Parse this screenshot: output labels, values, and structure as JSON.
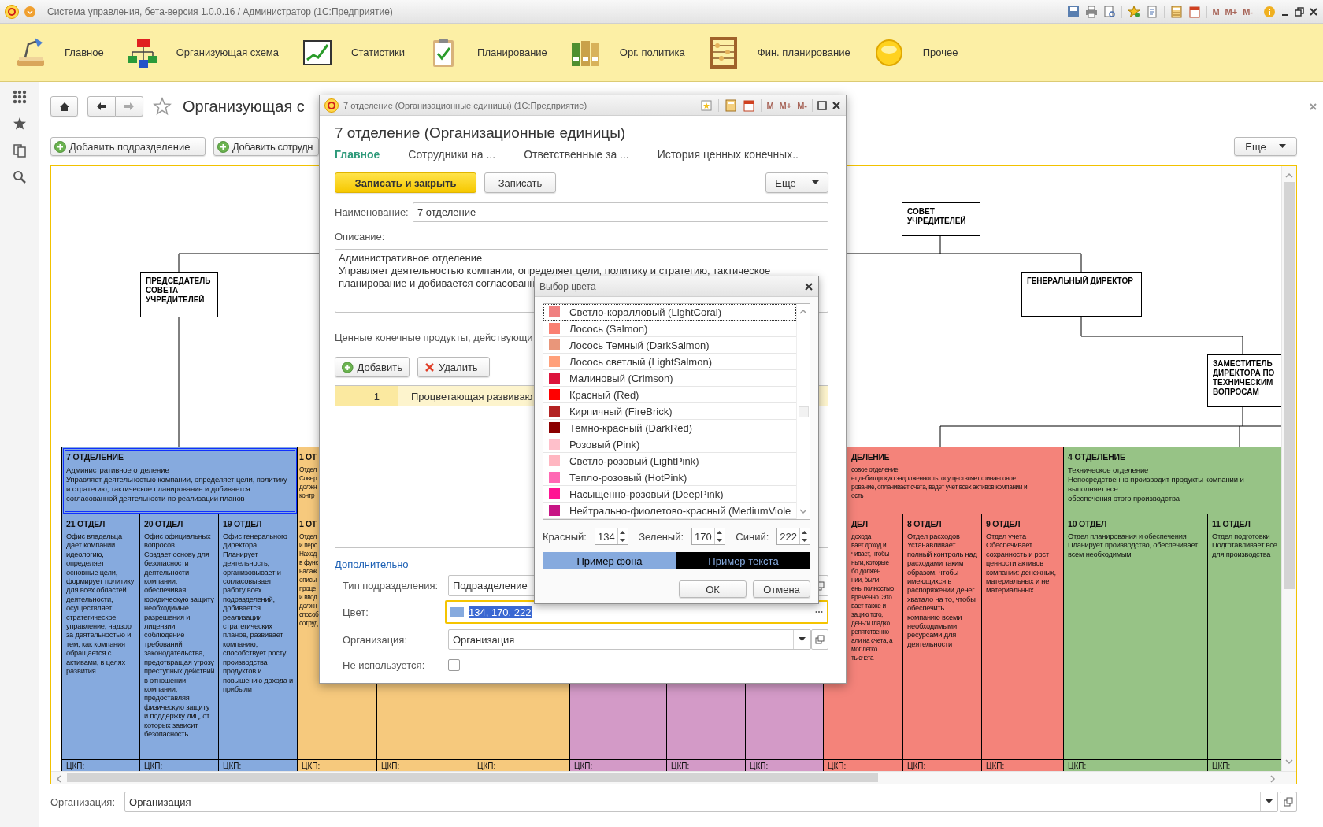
{
  "app_window": {
    "title": "Система управления, бета-версия 1.0.0.16 / Администратор  (1С:Предприятие)",
    "memory_buttons": [
      "M",
      "M+",
      "M-"
    ]
  },
  "sections": [
    {
      "label": "Главное"
    },
    {
      "label": "Организующая схема"
    },
    {
      "label": "Статистики"
    },
    {
      "label": "Планирование"
    },
    {
      "label": "Орг. политика"
    },
    {
      "label": "Фин. планирование"
    },
    {
      "label": "Прочее"
    }
  ],
  "page": {
    "title": "Организующая с",
    "buttons": [
      "Добавить подразделение",
      "Добавить сотрудн"
    ],
    "more_button": "Еще"
  },
  "chart": {
    "nodes": [
      {
        "label": "СОВЕТ УЧРЕДИТЕЛЕЙ"
      },
      {
        "label": "ПРЕДСЕДАТЕЛЬ СОВЕТА УЧРЕДИТЕЛЕЙ"
      },
      {
        "label": "ГЕНЕРАЛЬНЫЙ ДИРЕКТОР"
      },
      {
        "label": "ЗАМЕСТИТЕЛЬ ДИРЕКТОРА ПО ТЕХНИЧЕСКИМ ВОПРОСАМ"
      }
    ],
    "departments": [
      {
        "kind": "full",
        "color": "#86aade",
        "selected": true,
        "heading": "7 ОТДЕЛЕНИЕ",
        "text": "Административное отделение\nУправляет деятельностью компании, определяет цели, политику и стратегию, тактическое планирование и добивается согласованной деятельности по реализации планов",
        "units": [
          {
            "kind": "full",
            "heading": "21 ОТДЕЛ",
            "text": "Офис владельца\nДает компании идеологию, определяет основные цели, формирует политику для всех областей деятельности, осуществляет стратегическое управление, надзор за деятельностью и тем, как компания обращается с активами, в целях развития",
            "footer": "ЦКП:"
          },
          {
            "kind": "full",
            "heading": "20 ОТДЕЛ",
            "text": "Офис официальных вопросов\nСоздает основу для безопасности деятельности компании, обеспечивая юридическую защиту необходимые разрешения и лицензии, соблюдение требований законодательства, предотвращая угрозу преступных действий в отношении компании, предоставляя физическую защиту и поддержку лиц, от которых зависит безопасность",
            "footer": "ЦКП:"
          },
          {
            "kind": "full",
            "heading": "19 ОТДЕЛ",
            "text": "Офис генерального директора\nПланирует деятельность, организовывает и согласовывает работу всех подразделений, добивается реализации стратегических планов, развивает компанию, способствует росту производства продуктов и повышению дохода и прибыли",
            "footer": "ЦКП:"
          }
        ]
      },
      {
        "kind": "cut-right",
        "color": "#f6c97d",
        "selected": false,
        "heading": "1 ОТ",
        "text": "Отдел\nСовер\nдолжн\nконтр",
        "units": [
          {
            "kind": "cut-right",
            "heading": "1 ОТ",
            "text": "Отдел\nи перс\nНаход\nв функ\nналаж\nописы\nпроце\nи ввод\nдолжн\nспособ\nсотруд",
            "footer": "ЦКП:"
          },
          {
            "footer": "ЦКП:"
          },
          {
            "footer": "ЦКП:"
          }
        ]
      },
      {
        "color": "#d39ac7",
        "units": [
          {
            "footer": "ЦКП:"
          },
          {
            "footer": "ЦКП:"
          },
          {
            "footer": "ЦКП:"
          }
        ]
      },
      {
        "kind": "cut-left",
        "color": "#f4837a",
        "selected": false,
        "heading": "ДЕЛЕНИЕ",
        "text": "совое отделение\nет дебиторскую задолженность, осуществляет финансовое\nрование, оплачивает счета, ведет учет всех активов компании и\nость",
        "units": [
          {
            "kind": "cut-left",
            "heading": "ДЕЛ",
            "text": "дохода\nвает доход и\nчивает, чтобы\nньги, которые\nбо должен\nнии, были\nены полностью\nвременно. Это\nвает также и\nзацию того,\nденьги гладко\nрепятственно\nали на счета, а\nмог легко\nть счета",
            "footer": "ЦКП:"
          },
          {
            "kind": "full",
            "heading": "8 ОТДЕЛ",
            "text": "Отдел расходов\nУстанавливает полный контроль над расходами таким образом, чтобы имеющихся в распоряжении денег хватало на то, чтобы обеспечить компанию всеми необходимыми ресурсами для деятельности",
            "footer": "ЦКП:"
          },
          {
            "kind": "full",
            "heading": "9 ОТДЕЛ",
            "text": "Отдел учета\nОбеспечивает сохранность и рост ценности активов компании: денежных, материальных и не материальных",
            "footer": "ЦКП:"
          }
        ]
      },
      {
        "kind": "full",
        "color": "#97c386",
        "selected": false,
        "heading": "4 ОТДЕЛЕНИЕ",
        "text": "Техническое отделение\nНепосредственно производит продукты компании и выполняет все\nобеспечения этого производства",
        "units": [
          {
            "kind": "full",
            "heading": "10 ОТДЕЛ",
            "text": "Отдел планирования и обеспечения\nПланирует производство, обеспечивает всем необходимым",
            "footer": "ЦКП:"
          },
          {
            "kind": "full",
            "heading": "11 ОТДЕЛ",
            "text": "Отдел подготовки\nПодготавливает все для производства",
            "footer": "ЦКП:"
          }
        ]
      }
    ]
  },
  "organization_field": {
    "label": "Организация:",
    "value": "Организация"
  },
  "dialog": {
    "window_title": "7 отделение (Организационные единицы)  (1С:Предприятие)",
    "memory_buttons": [
      "M",
      "M+",
      "M-"
    ],
    "heading": "7 отделение (Организационные единицы)",
    "tabs": [
      {
        "label": "Главное",
        "selected": true
      },
      {
        "label": "Сотрудники на ...",
        "selected": false
      },
      {
        "label": "Ответственные за ...",
        "selected": false
      },
      {
        "label": "История ценных конечных..",
        "selected": false
      }
    ],
    "save_close_button": "Записать и закрыть",
    "save_button": "Записать",
    "more_button": "Еще",
    "name_field": {
      "label": "Наименование:",
      "value": "7 отделение"
    },
    "description": {
      "label": "Описание:",
      "value": "Административное отделение\nУправляет деятельностью компании, определяет цели, политику и стратегию, тактическое\nпланирование и добивается согласованн"
    },
    "products": {
      "label": "Ценные конечные продукты, действующи",
      "buttons": [
        {
          "kind": "add",
          "label": "Добавить"
        },
        {
          "kind": "delete",
          "label": "Удалить"
        }
      ],
      "rows": [
        {
          "number": "1",
          "text": "Процветающая развиваю",
          "selected": true
        }
      ]
    },
    "more_link": "Дополнительно",
    "type_field": {
      "label": "Тип подразделения:",
      "value": "Подразделение"
    },
    "color_field": {
      "label": "Цвет:",
      "value": "134, 170, 222",
      "color": "#86aade",
      "focused": true
    },
    "org_field": {
      "label": "Организация:",
      "value": "Организация"
    },
    "unused": {
      "label": "Не используется:",
      "checked": false
    }
  },
  "color_dialog": {
    "title": "Выбор цвета",
    "colors": [
      {
        "label": "Светло-коралловый (LightCoral)",
        "color": "#f08080",
        "selected": true
      },
      {
        "label": "Лосось (Salmon)",
        "color": "#fa8072",
        "selected": false
      },
      {
        "label": "Лосось Темный (DarkSalmon)",
        "color": "#e9967a",
        "selected": false
      },
      {
        "label": "Лосось светлый (LightSalmon)",
        "color": "#ffa07a",
        "selected": false
      },
      {
        "label": "Малиновый (Crimson)",
        "color": "#dc143c",
        "selected": false
      },
      {
        "label": "Красный (Red)",
        "color": "#ff0000",
        "selected": false
      },
      {
        "label": "Кирпичный (FireBrick)",
        "color": "#b22222",
        "selected": false
      },
      {
        "label": "Темно-красный (DarkRed)",
        "color": "#8b0000",
        "selected": false
      },
      {
        "label": "Розовый (Pink)",
        "color": "#ffc0cb",
        "selected": false
      },
      {
        "label": "Светло-розовый (LightPink)",
        "color": "#ffb6c1",
        "selected": false
      },
      {
        "label": "Тепло-розовый (HotPink)",
        "color": "#ff69b4",
        "selected": false
      },
      {
        "label": "Насыщенно-розовый (DeepPink)",
        "color": "#ff1493",
        "selected": false
      },
      {
        "label": "Нейтрально-фиолетово-красный (MediumViole",
        "color": "#c71585",
        "selected": false
      }
    ],
    "channels": [
      {
        "label": "Красный:",
        "value": "134"
      },
      {
        "label": "Зеленый:",
        "value": "170"
      },
      {
        "label": "Синий:",
        "value": "222"
      }
    ],
    "background_sample": "Пример фона",
    "text_sample": "Пример текста",
    "ok_button": "ОК",
    "cancel_button": "Отмена"
  }
}
